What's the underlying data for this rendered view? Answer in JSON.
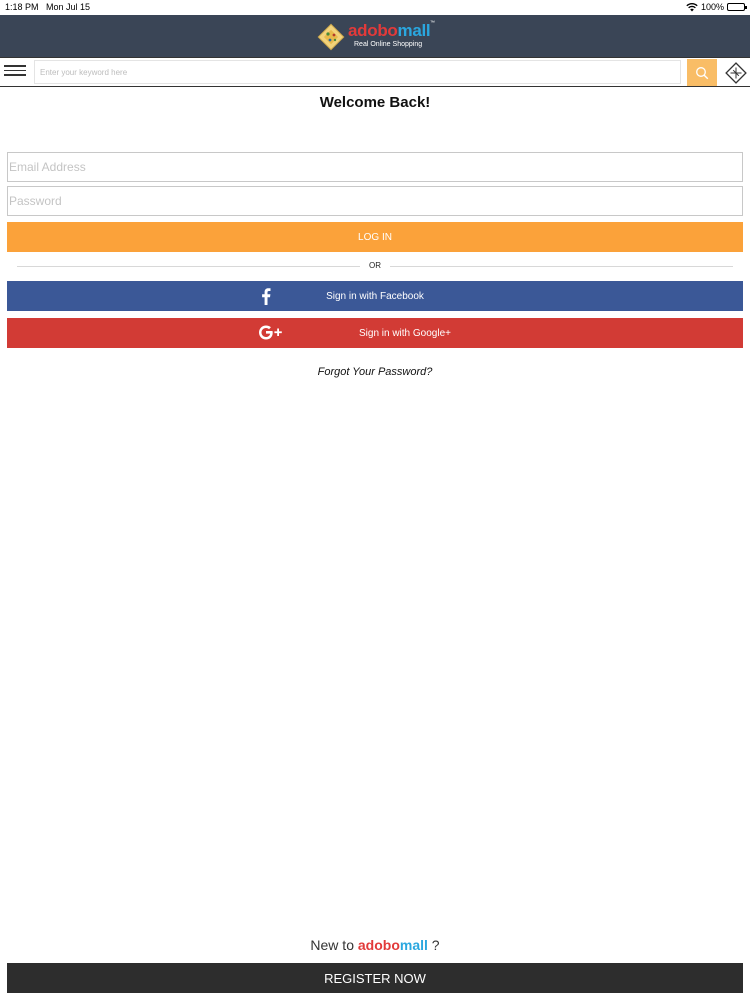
{
  "status_bar": {
    "time": "1:18 PM",
    "date": "Mon Jul 15",
    "battery": "100%"
  },
  "header": {
    "brand_part1": "adobo",
    "brand_part2": "mall",
    "tagline": "Real Online Shopping",
    "trademark": "™",
    "colors": {
      "bar": "#3a4556",
      "brand_red": "#e23a3a",
      "brand_blue": "#2aa7df"
    }
  },
  "search": {
    "placeholder": "Enter your keyword here",
    "colors": {
      "button": "#f9bd66"
    }
  },
  "login": {
    "title": "Welcome Back!",
    "email_placeholder": "Email Address",
    "password_placeholder": "Password",
    "login_label": "LOG IN",
    "or_label": "OR",
    "facebook_label": "Sign in with Facebook",
    "google_label": "Sign in with Google+",
    "forgot_label": "Forgot Your Password?",
    "colors": {
      "login": "#fba23a",
      "facebook": "#3b5897",
      "google": "#d23b35"
    }
  },
  "register": {
    "prompt_prefix": "New to ",
    "brand_part1": "adobo",
    "brand_part2": "mall",
    "prompt_suffix": " ?",
    "button_label": "REGISTER NOW",
    "colors": {
      "button": "#2d2d2d"
    }
  },
  "icons": {
    "menu": "hamburger-menu-icon",
    "search": "search-icon",
    "cube": "cube-icon",
    "facebook": "facebook-icon",
    "google": "google-plus-icon",
    "logo": "adobomall-logo"
  }
}
